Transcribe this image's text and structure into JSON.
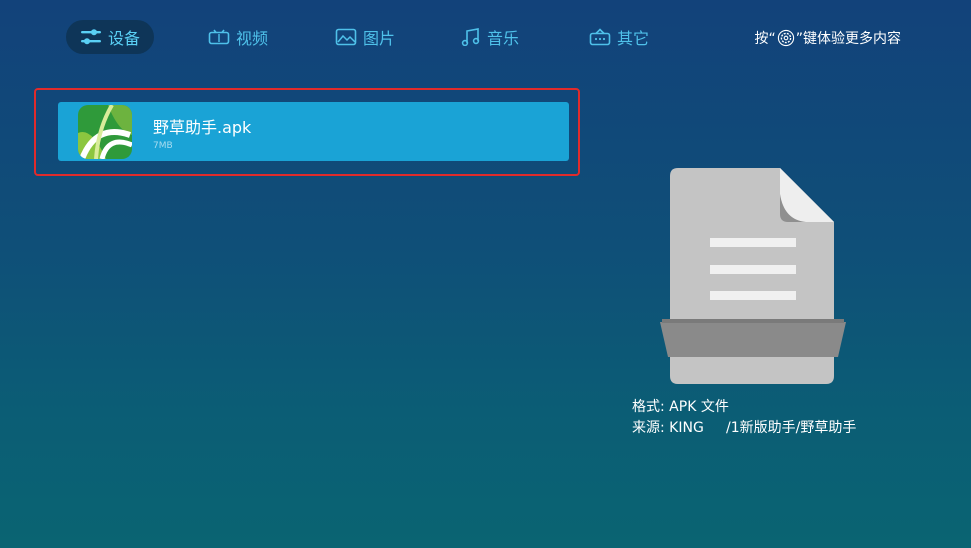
{
  "tabs": [
    {
      "id": "device",
      "label": "设备",
      "icon": "sliders-icon",
      "active": true
    },
    {
      "id": "video",
      "label": "视频",
      "icon": "video-icon",
      "active": false
    },
    {
      "id": "picture",
      "label": "图片",
      "icon": "picture-icon",
      "active": false
    },
    {
      "id": "music",
      "label": "音乐",
      "icon": "music-note-icon",
      "active": false
    },
    {
      "id": "other",
      "label": "其它",
      "icon": "box-icon",
      "active": false
    }
  ],
  "hint": {
    "prefix": "按“",
    "suffix": "”键体验更多内容",
    "icon": "settings-icon"
  },
  "file": {
    "name": "野草助手.apk",
    "size": "7MB",
    "icon": "app-icon"
  },
  "details": {
    "format_label": "格式:",
    "format_value": "APK 文件",
    "source_label": "来源:",
    "source_value": "KING     /1新版助手/野草助手"
  },
  "colors": {
    "accent": "#4fc1ea",
    "selection_border": "#e12b2b",
    "item_bg": "#1aa3d6"
  }
}
